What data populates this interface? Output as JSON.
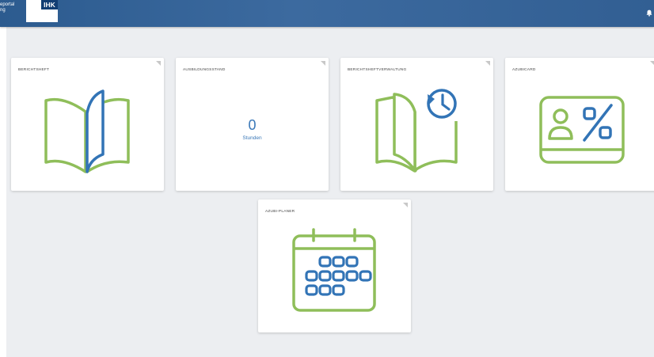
{
  "header": {
    "brand_line1": "eportal",
    "brand_line2": "ng",
    "logo_text": "IHK",
    "bell_icon": "bell-icon"
  },
  "colors": {
    "green": "#8fbe5a",
    "blue": "#3274b6",
    "header": "#34639a"
  },
  "tiles": [
    {
      "title": "BERICHTSHEFT",
      "icon": "open-book-icon"
    },
    {
      "title": "AUSBILDUNGSSTAND",
      "value": "0",
      "unit": "Stunden"
    },
    {
      "title": "BERICHTSHEFTVERWALTUNG",
      "icon": "book-history-icon"
    },
    {
      "title": "AZUBICARD",
      "icon": "id-card-percent-icon"
    },
    {
      "title": "AZUBI-PLANER",
      "icon": "calendar-icon"
    }
  ]
}
